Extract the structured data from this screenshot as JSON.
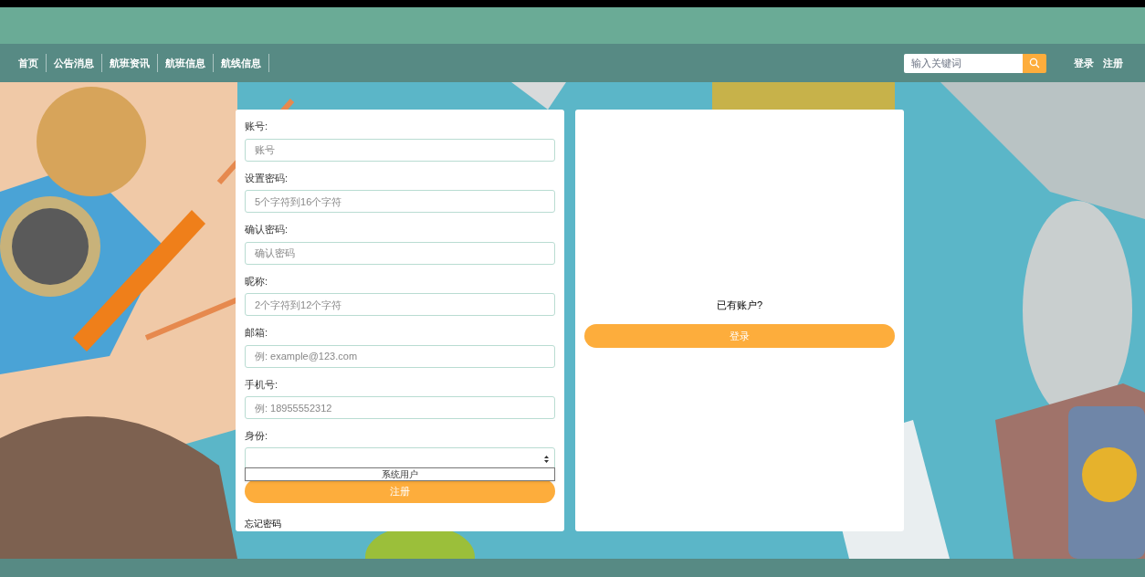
{
  "nav": {
    "items": [
      {
        "label": "首页"
      },
      {
        "label": "公告消息"
      },
      {
        "label": "航班资讯"
      },
      {
        "label": "航班信息"
      },
      {
        "label": "航线信息"
      }
    ]
  },
  "search": {
    "placeholder": "输入关键词"
  },
  "auth_links": [
    "登录",
    "注册"
  ],
  "register_form": {
    "fields": [
      {
        "label": "账号:",
        "kind": "text",
        "placeholder": "账号"
      },
      {
        "label": "设置密码:",
        "kind": "text",
        "placeholder": "5个字符到16个字符"
      },
      {
        "label": "确认密码:",
        "kind": "text",
        "placeholder": "确认密码"
      },
      {
        "label": "昵称:",
        "kind": "text",
        "placeholder": "2个字符到12个字符"
      },
      {
        "label": "邮箱:",
        "kind": "text",
        "placeholder": "例: example@123.com"
      },
      {
        "label": "手机号:",
        "kind": "text",
        "placeholder": "例: 18955552312"
      },
      {
        "label": "身份:",
        "kind": "select",
        "options": [
          {
            "label": "系统用户",
            "selected": false
          }
        ]
      }
    ],
    "submit": "注册",
    "forgot": "忘记密码"
  },
  "login_panel": {
    "prompt": "已有账户?",
    "button": "登录"
  }
}
